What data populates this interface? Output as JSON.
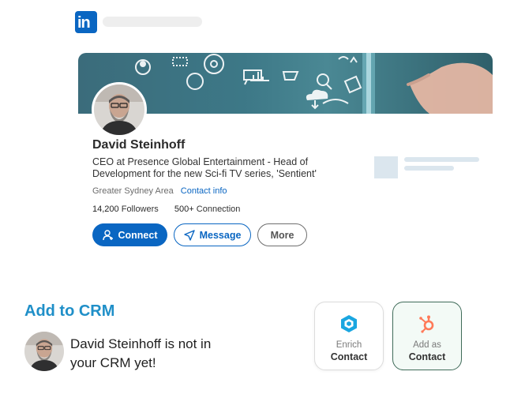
{
  "header": {
    "logo_text": "in",
    "logo_color": "#0a66c2"
  },
  "profile": {
    "name": "David Steinhoff",
    "headline": "CEO at Presence Global Entertainment - Head of Development for the new Sci-fi TV series, 'Sentient'",
    "location": "Greater Sydney Area",
    "contact_info_label": "Contact info",
    "followers_count": "14,200",
    "followers_label": "Followers",
    "connections_count": "500+",
    "connections_label": "Connection",
    "buttons": {
      "connect": "Connect",
      "message": "Message",
      "more": "More"
    }
  },
  "crm": {
    "title": "Add to CRM",
    "message": "David Steinhoff is not in your CRM yet!",
    "enrich": {
      "line1": "Enrich",
      "line2": "Contact",
      "icon": "enrich-logo-icon"
    },
    "add": {
      "line1": "Add as",
      "line2": "Contact",
      "icon": "hubspot-icon"
    }
  },
  "colors": {
    "linkedin_blue": "#0a66c2",
    "crm_title": "#1f8fc8",
    "hubspot_orange": "#ff7a59",
    "add_tile_border": "#3f6b59"
  }
}
